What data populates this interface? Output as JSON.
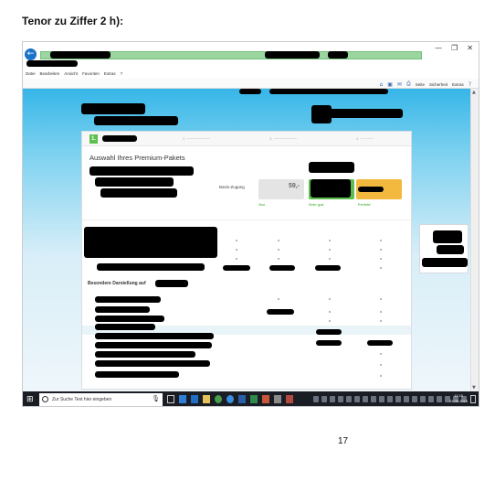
{
  "document": {
    "heading": "Tenor zu Ziffer 2 h):",
    "page_number": "17"
  },
  "browser": {
    "menu": [
      "Datei",
      "Bearbeiten",
      "Ansicht",
      "Favoriten",
      "Extras",
      "?"
    ],
    "toolbar": [
      "Seite",
      "Sicherheit",
      "Extras"
    ],
    "window_controls": [
      "—",
      "❐",
      "✕"
    ]
  },
  "page": {
    "step_1": "1.",
    "package_title": "Auswahl Ihres Premium-Pakets",
    "basis_label": "Basis-Zugang",
    "basis_price": "59,-",
    "tag_1": "Gut",
    "tag_2": "Sehr gut",
    "tag_3": "Perfekt",
    "section_special": "Besondere Darstellung auf"
  },
  "taskbar": {
    "search_placeholder": "Zur Suche Text hier eingeben",
    "time": "11:15",
    "date": "23.05.2019"
  },
  "colors": {
    "accent_green": "#5cbf4d",
    "accent_orange": "#f2b93e",
    "brand_blue": "#36b6e8"
  }
}
